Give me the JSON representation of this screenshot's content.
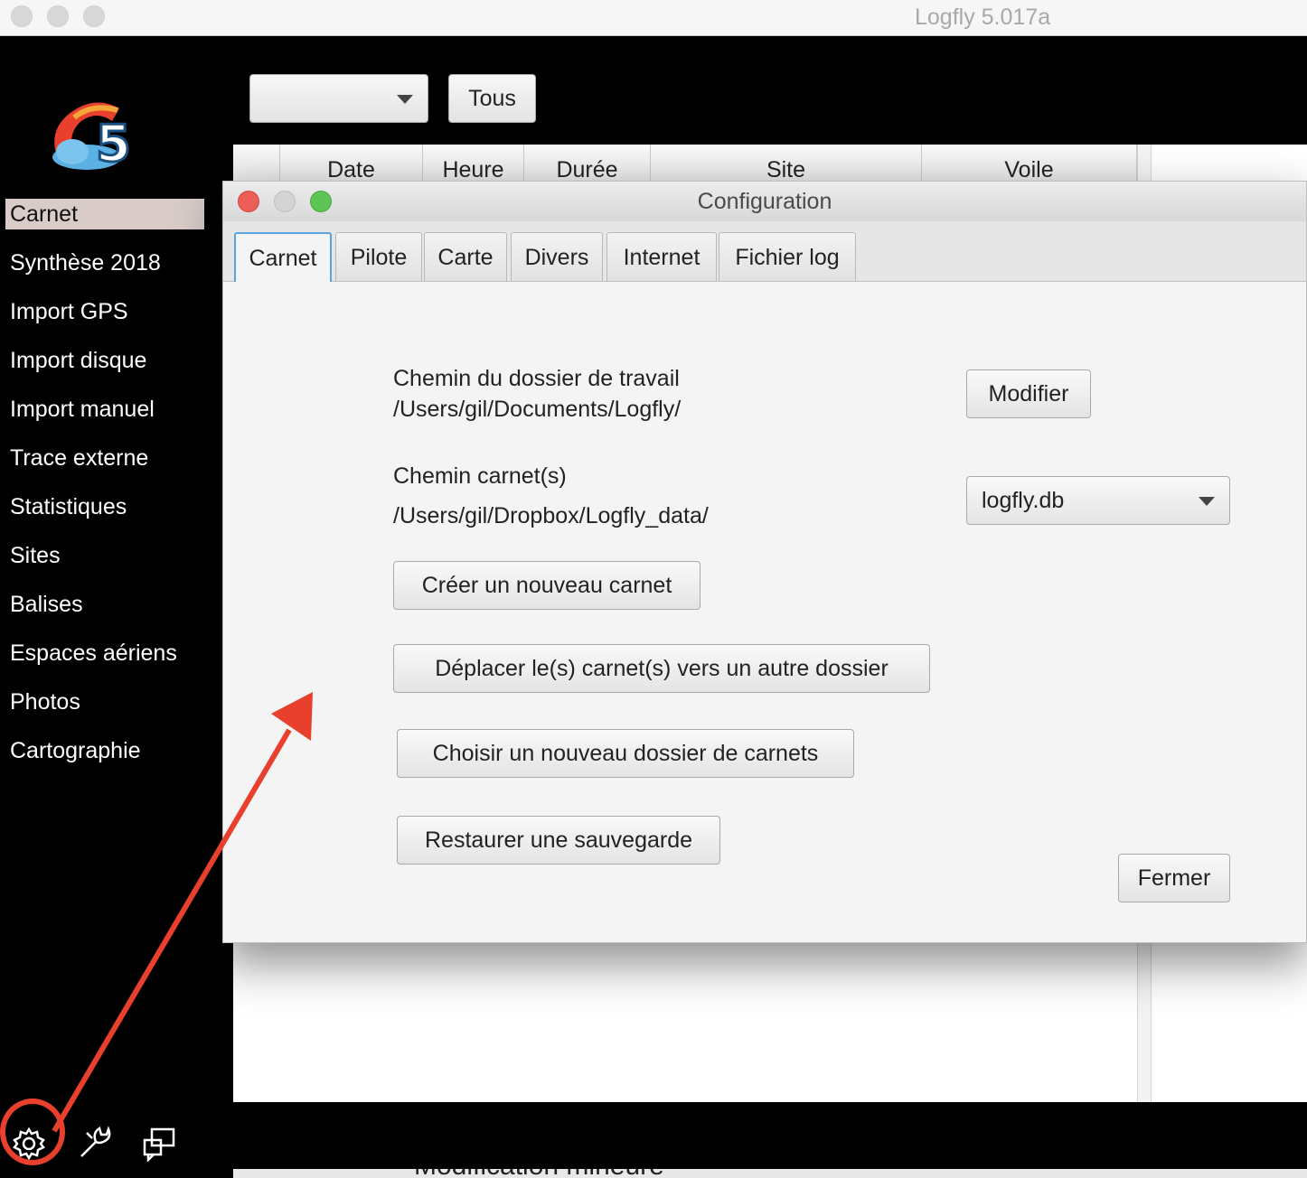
{
  "window": {
    "title": "Logfly 5.017a"
  },
  "sidebar": {
    "items": [
      {
        "label": "Carnet",
        "active": true
      },
      {
        "label": "Synthèse 2018"
      },
      {
        "label": "Import GPS"
      },
      {
        "label": "Import disque"
      },
      {
        "label": "Import manuel"
      },
      {
        "label": "Trace externe"
      },
      {
        "label": "Statistiques"
      },
      {
        "label": "Sites"
      },
      {
        "label": "Balises"
      },
      {
        "label": "Espaces aériens"
      },
      {
        "label": "Photos"
      },
      {
        "label": "Cartographie"
      }
    ],
    "bottom_icons": [
      "gear-icon",
      "wrench-icon",
      "support-icon"
    ]
  },
  "toolbar": {
    "filter_value": "",
    "all_button": "Tous"
  },
  "table": {
    "columns": [
      "",
      "Date",
      "Heure",
      "Durée",
      "Site",
      "Voile"
    ]
  },
  "background_text": "Modification mineure",
  "dialog": {
    "title": "Configuration",
    "tabs": [
      "Carnet",
      "Pilote",
      "Carte",
      "Divers",
      "Internet",
      "Fichier log"
    ],
    "active_tab": "Carnet",
    "work_folder_label": "Chemin du dossier de travail",
    "work_folder_path": "/Users/gil/Documents/Logfly/",
    "modify_button": "Modifier",
    "logbook_path_label": "Chemin carnet(s)",
    "logbook_path": "/Users/gil/Dropbox/Logfly_data/",
    "logbook_select": "logfly.db",
    "buttons": {
      "new_logbook": "Créer un nouveau carnet",
      "move_logbooks": "Déplacer le(s) carnet(s) vers un autre dossier",
      "choose_folder": "Choisir un nouveau dossier de carnets",
      "restore_backup": "Restaurer une sauvegarde",
      "close": "Fermer"
    }
  },
  "colors": {
    "annotation": "#e8402c",
    "tab_focus": "#5aa4dd",
    "active_nav": "#d8cbc8"
  }
}
